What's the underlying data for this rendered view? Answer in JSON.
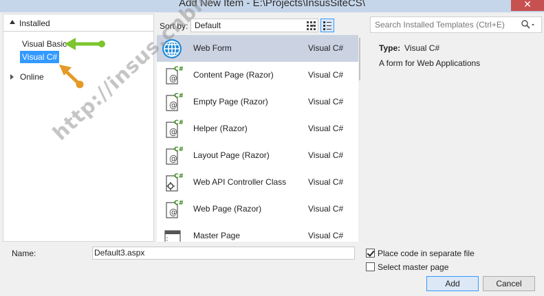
{
  "window": {
    "title": "Add New Item - E:\\Projects\\InsusSiteCS\\",
    "close_glyph": "✕"
  },
  "left_pane": {
    "header": "Installed",
    "items": [
      {
        "label": "Visual Basic"
      },
      {
        "label": "Visual C#",
        "selected": true
      },
      {
        "label": "Online"
      }
    ]
  },
  "toolbar": {
    "sort_label": "Sort by:",
    "sort_value": "Default",
    "search_placeholder": "Search Installed Templates (Ctrl+E)"
  },
  "templates": [
    {
      "name": "Web Form",
      "lang": "Visual C#",
      "icon": "globe-icon",
      "selected": true
    },
    {
      "name": "Content Page (Razor)",
      "lang": "Visual C#",
      "icon": "razor-page-icon"
    },
    {
      "name": "Empty Page (Razor)",
      "lang": "Visual C#",
      "icon": "razor-page-icon"
    },
    {
      "name": "Helper (Razor)",
      "lang": "Visual C#",
      "icon": "razor-page-icon"
    },
    {
      "name": "Layout Page (Razor)",
      "lang": "Visual C#",
      "icon": "razor-page-icon"
    },
    {
      "name": "Web API Controller Class",
      "lang": "Visual C#",
      "icon": "controller-class-icon"
    },
    {
      "name": "Web Page (Razor)",
      "lang": "Visual C#",
      "icon": "razor-page-icon"
    },
    {
      "name": "Master Page",
      "lang": "Visual C#",
      "icon": "master-page-icon"
    }
  ],
  "details": {
    "type_label": "Type:",
    "type_value": "Visual C#",
    "description": "A form for Web Applications"
  },
  "bottom": {
    "name_label": "Name:",
    "name_value": "Default3.aspx",
    "place_code_label": "Place code in separate file",
    "place_code_checked": true,
    "master_page_label": "Select master page",
    "master_page_checked": false,
    "add_label": "Add",
    "cancel_label": "Cancel"
  },
  "watermark": "http://insus.cnblogs.com",
  "colors": {
    "selection": "#3399ff",
    "item_selected": "#cbd3e2",
    "green_arrow": "#7cc52e",
    "orange_arrow": "#e59a27"
  }
}
